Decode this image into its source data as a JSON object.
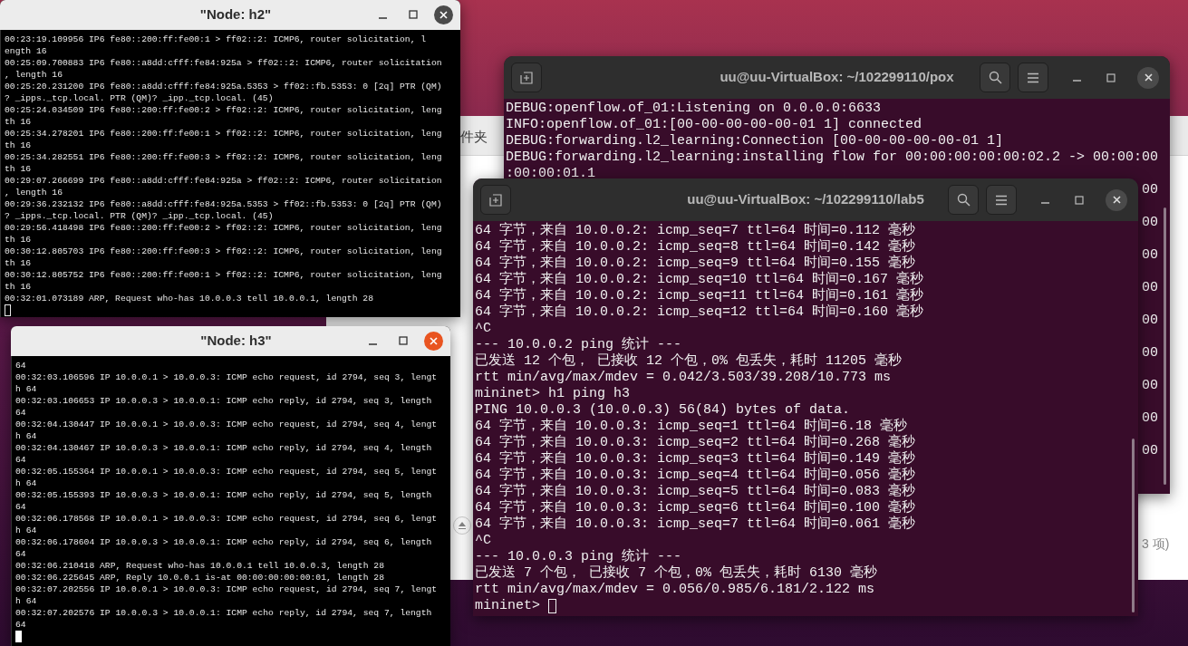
{
  "file_manager": {
    "toolbar_text": "件夹",
    "status_text": "3 项)"
  },
  "windows": [
    {
      "kind": "gnome",
      "title": "uu@uu-VirtualBox: ~/102299110/pox",
      "lines": [
        "DEBUG:openflow.of_01:Listening on 0.0.0.0:6633",
        "INFO:openflow.of_01:[00-00-00-00-00-01 1] connected",
        "DEBUG:forwarding.l2_learning:Connection [00-00-00-00-00-01 1]",
        "DEBUG:forwarding.l2_learning:installing flow for 00:00:00:00:00:02.2 -> 00:00:00",
        ":00:00:01.1"
      ],
      "tail_fragments": [
        "00",
        "00",
        "00",
        "00",
        "00",
        "00",
        "00",
        "00",
        "00"
      ]
    },
    {
      "kind": "gnome",
      "title": "uu@uu-VirtualBox: ~/102299110/lab5",
      "lines": [
        "64 字节，来自 10.0.0.2: icmp_seq=7 ttl=64 时间=0.112 毫秒",
        "64 字节，来自 10.0.0.2: icmp_seq=8 ttl=64 时间=0.142 毫秒",
        "64 字节，来自 10.0.0.2: icmp_seq=9 ttl=64 时间=0.155 毫秒",
        "64 字节，来自 10.0.0.2: icmp_seq=10 ttl=64 时间=0.167 毫秒",
        "64 字节，来自 10.0.0.2: icmp_seq=11 ttl=64 时间=0.161 毫秒",
        "64 字节，来自 10.0.0.2: icmp_seq=12 ttl=64 时间=0.160 毫秒",
        "^C",
        "--- 10.0.0.2 ping 统计 ---",
        "已发送 12 个包， 已接收 12 个包，0% 包丢失，耗时 11205 毫秒",
        "rtt min/avg/max/mdev = 0.042/3.503/39.208/10.773 ms",
        "mininet> h1 ping h3",
        "PING 10.0.0.3 (10.0.0.3) 56(84) bytes of data.",
        "64 字节，来自 10.0.0.3: icmp_seq=1 ttl=64 时间=6.18 毫秒",
        "64 字节，来自 10.0.0.3: icmp_seq=2 ttl=64 时间=0.268 毫秒",
        "64 字节，来自 10.0.0.3: icmp_seq=3 ttl=64 时间=0.149 毫秒",
        "64 字节，来自 10.0.0.3: icmp_seq=4 ttl=64 时间=0.056 毫秒",
        "64 字节，来自 10.0.0.3: icmp_seq=5 ttl=64 时间=0.083 毫秒",
        "64 字节，来自 10.0.0.3: icmp_seq=6 ttl=64 时间=0.100 毫秒",
        "64 字节，来自 10.0.0.3: icmp_seq=7 ttl=64 时间=0.061 毫秒",
        "^C",
        "--- 10.0.0.3 ping 统计 ---",
        "已发送 7 个包， 已接收 7 个包，0% 包丢失，耗时 6130 毫秒",
        "rtt min/avg/max/mdev = 0.056/0.985/6.181/2.122 ms",
        "mininet> "
      ],
      "cursor_filled": false
    },
    {
      "kind": "xterm",
      "title": "\"Node: h2\"",
      "focused": false,
      "lines": [
        "00:23:19.109956 IP6 fe80::200:ff:fe00:1 > ff02::2: ICMP6, router solicitation, l",
        "ength 16",
        "00:25:09.700883 IP6 fe80::a8dd:cfff:fe84:925a > ff02::2: ICMP6, router solicitation",
        ", length 16",
        "00:25:20.231200 IP6 fe80::a8dd:cfff:fe84:925a.5353 > ff02::fb.5353: 0 [2q] PTR (QM)",
        "? _ipps._tcp.local. PTR (QM)? _ipp._tcp.local. (45)",
        "00:25:24.034509 IP6 fe80::200:ff:fe00:2 > ff02::2: ICMP6, router solicitation, leng",
        "th 16",
        "00:25:34.278201 IP6 fe80::200:ff:fe00:1 > ff02::2: ICMP6, router solicitation, leng",
        "th 16",
        "00:25:34.282551 IP6 fe80::200:ff:fe00:3 > ff02::2: ICMP6, router solicitation, leng",
        "th 16",
        "00:29:07.266699 IP6 fe80::a8dd:cfff:fe84:925a > ff02::2: ICMP6, router solicitation",
        ", length 16",
        "00:29:36.232132 IP6 fe80::a8dd:cfff:fe84:925a.5353 > ff02::fb.5353: 0 [2q] PTR (QM)",
        "? _ipps._tcp.local. PTR (QM)? _ipp._tcp.local. (45)",
        "00:29:56.418498 IP6 fe80::200:ff:fe00:2 > ff02::2: ICMP6, router solicitation, leng",
        "th 16",
        "00:30:12.805703 IP6 fe80::200:ff:fe00:3 > ff02::2: ICMP6, router solicitation, leng",
        "th 16",
        "00:30:12.805752 IP6 fe80::200:ff:fe00:1 > ff02::2: ICMP6, router solicitation, leng",
        "th 16",
        "00:32:01.073189 ARP, Request who-has 10.0.0.3 tell 10.0.0.1, length 28"
      ],
      "cursor_filled": false
    },
    {
      "kind": "xterm",
      "title": "\"Node: h3\"",
      "focused": true,
      "lines": [
        "64",
        "00:32:03.106596 IP 10.0.0.1 > 10.0.0.3: ICMP echo request, id 2794, seq 3, lengt",
        "h 64",
        "00:32:03.106653 IP 10.0.0.3 > 10.0.0.1: ICMP echo reply, id 2794, seq 3, length",
        "64",
        "00:32:04.130447 IP 10.0.0.1 > 10.0.0.3: ICMP echo request, id 2794, seq 4, lengt",
        "h 64",
        "00:32:04.130467 IP 10.0.0.3 > 10.0.0.1: ICMP echo reply, id 2794, seq 4, length",
        "64",
        "00:32:05.155364 IP 10.0.0.1 > 10.0.0.3: ICMP echo request, id 2794, seq 5, lengt",
        "h 64",
        "00:32:05.155393 IP 10.0.0.3 > 10.0.0.1: ICMP echo reply, id 2794, seq 5, length",
        "64",
        "00:32:06.178568 IP 10.0.0.1 > 10.0.0.3: ICMP echo request, id 2794, seq 6, lengt",
        "h 64",
        "00:32:06.178604 IP 10.0.0.3 > 10.0.0.1: ICMP echo reply, id 2794, seq 6, length",
        "64",
        "00:32:06.210418 ARP, Request who-has 10.0.0.1 tell 10.0.0.3, length 28",
        "00:32:06.225645 ARP, Reply 10.0.0.1 is-at 00:00:00:00:00:01, length 28",
        "00:32:07.202556 IP 10.0.0.1 > 10.0.0.3: ICMP echo request, id 2794, seq 7, lengt",
        "h 64",
        "00:32:07.202576 IP 10.0.0.3 > 10.0.0.1: ICMP echo reply, id 2794, seq 7, length",
        "64"
      ],
      "cursor_filled": true
    }
  ]
}
